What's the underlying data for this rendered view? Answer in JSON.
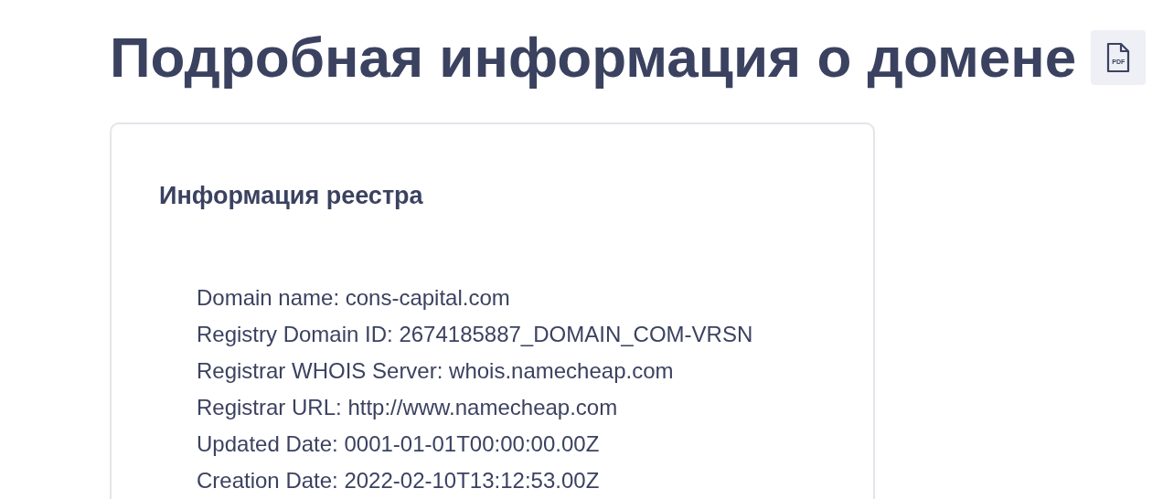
{
  "title": "Подробная информация о домене",
  "pdf_button": {
    "label": "PDF"
  },
  "card": {
    "heading": "Информация реестра",
    "lines": [
      "Domain name: cons-capital.com",
      "Registry Domain ID: 2674185887_DOMAIN_COM-VRSN",
      "Registrar WHOIS Server: whois.namecheap.com",
      "Registrar URL: http://www.namecheap.com",
      "Updated Date: 0001-01-01T00:00:00.00Z",
      "Creation Date: 2022-02-10T13:12:53.00Z"
    ]
  }
}
